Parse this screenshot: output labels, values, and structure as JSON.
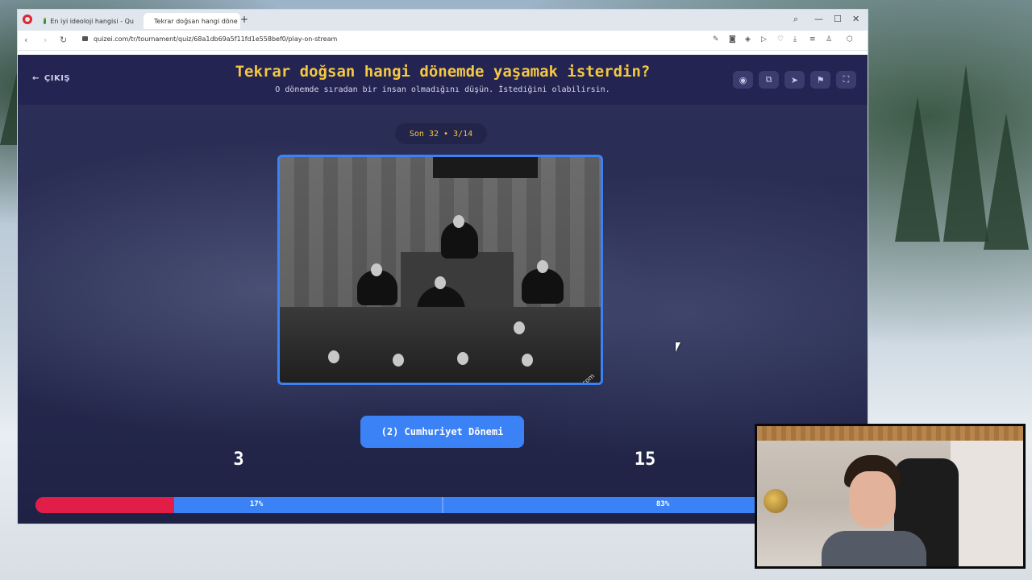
{
  "browser": {
    "tabs": [
      {
        "label": "En iyi ideoloji hangisi - Qu",
        "active": false
      },
      {
        "label": "Tekrar doğsan hangi döne",
        "active": true
      }
    ],
    "url": "quizei.com/tr/tournament/quiz/68a1db69a5f11fd1e558bef0/play-on-stream"
  },
  "header": {
    "exit_label": "ÇIKIŞ",
    "title": "Tekrar doğsan hangi dönemde yaşamak isterdin?",
    "subtitle": "O dönemde sıradan bir insan olmadığını düşün. İstediğini olabilirsin.",
    "icons": [
      "eye-icon",
      "share-icon",
      "send-icon",
      "flag-icon",
      "fullscreen-icon"
    ]
  },
  "round": {
    "label": "Son 32 • 3/14"
  },
  "choice": {
    "label": "(2) Cumhuriyet Dönemi",
    "image_watermark": "www.ataturk.com"
  },
  "votes": {
    "left": {
      "count": "3",
      "percent_label": "17%",
      "percent": 17
    },
    "right": {
      "count": "15",
      "percent_label": "83%",
      "percent": 83
    }
  },
  "colors": {
    "accent": "#3b82f6",
    "title": "#f5c842",
    "vote_left": "#e11d48",
    "vote_right": "#3b82f6"
  }
}
